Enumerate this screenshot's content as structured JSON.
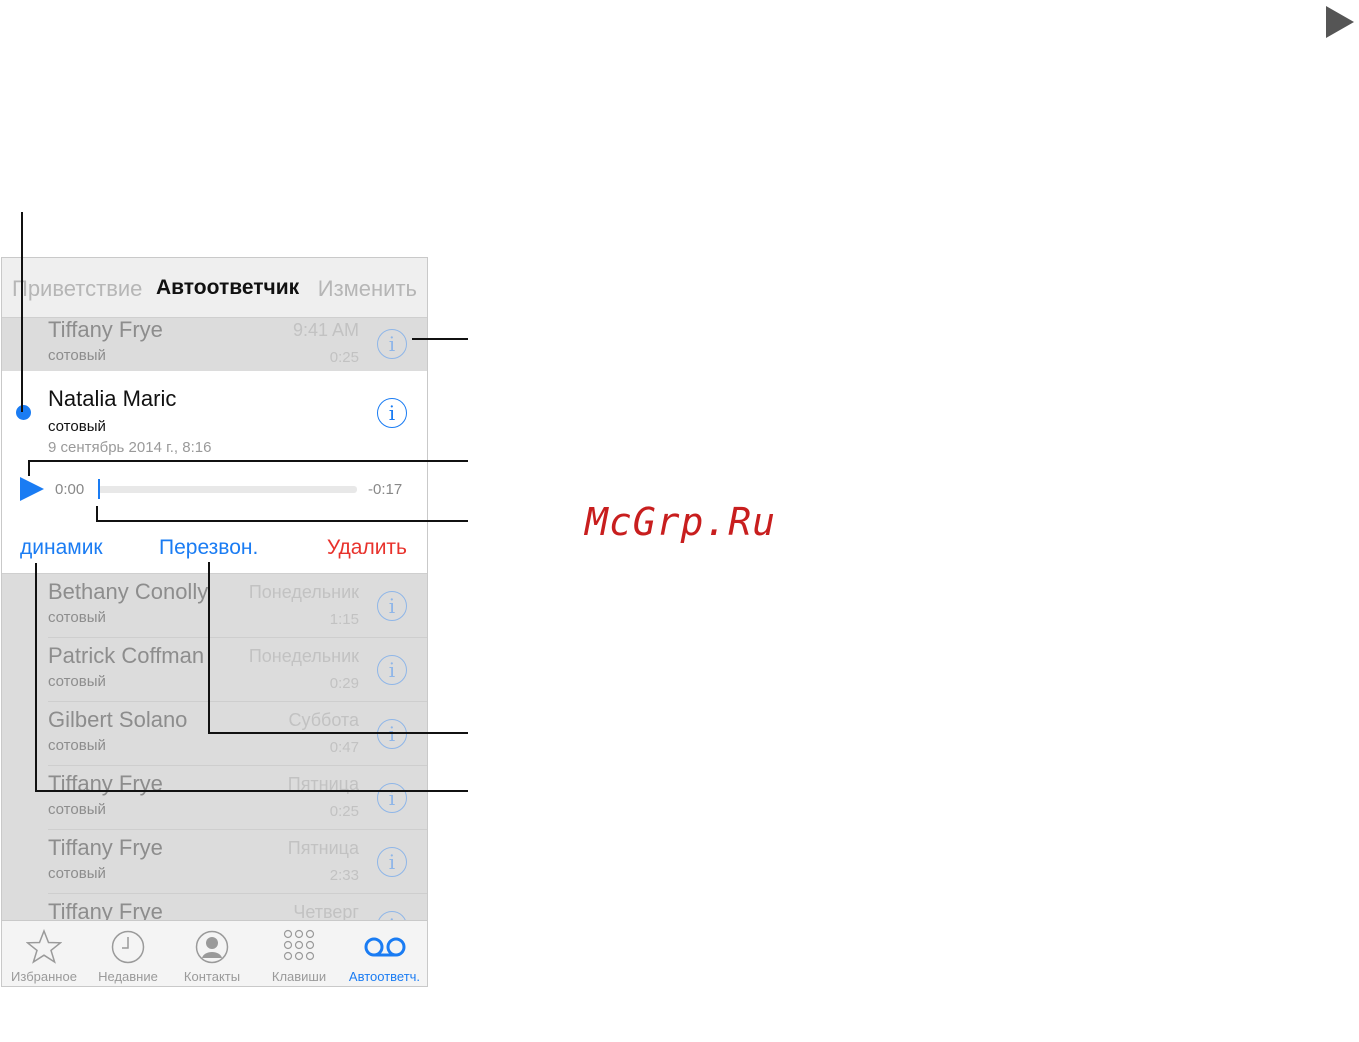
{
  "watermark": "McGrp.Ru",
  "navbar": {
    "left": "Приветствие",
    "title": "Автоответчик",
    "right": "Изменить"
  },
  "top_row": {
    "name": "Tiffany Frye",
    "type": "сотовый",
    "date": "9:41 AM",
    "duration": "0:25"
  },
  "expanded": {
    "name": "Natalia Maric",
    "type": "сотовый",
    "date": "9 сентябрь 2014 г., 8:16",
    "time_elapsed": "0:00",
    "time_remaining": "-0:17",
    "progress": 0,
    "speaker_label": "динамик",
    "callback_label": "Перезвон.",
    "delete_label": "Удалить"
  },
  "messages": [
    {
      "name": "Bethany Conolly",
      "type": "сотовый",
      "date": "Понедельник",
      "duration": "1:15"
    },
    {
      "name": "Patrick Coffman",
      "type": "сотовый",
      "date": "Понедельник",
      "duration": "0:29"
    },
    {
      "name": "Gilbert Solano",
      "type": "сотовый",
      "date": "Суббота",
      "duration": "0:47"
    },
    {
      "name": "Tiffany Frye",
      "type": "сотовый",
      "date": "Пятница",
      "duration": "0:25"
    },
    {
      "name": "Tiffany Frye",
      "type": "сотовый",
      "date": "Пятница",
      "duration": "2:33"
    },
    {
      "name": "Tiffany Frye",
      "type": "",
      "date": "Четверг",
      "duration": ""
    }
  ],
  "tabs": [
    {
      "label": "Избранное",
      "icon": "star-icon"
    },
    {
      "label": "Недавние",
      "icon": "clock-icon"
    },
    {
      "label": "Контакты",
      "icon": "contact-icon"
    },
    {
      "label": "Клавиши",
      "icon": "keypad-icon"
    },
    {
      "label": "Автоответч.",
      "icon": "voicemail-icon",
      "active": true
    }
  ],
  "colors": {
    "accent": "#1a7cf3",
    "delete": "#e8322c",
    "watermark": "#c81e1e"
  }
}
